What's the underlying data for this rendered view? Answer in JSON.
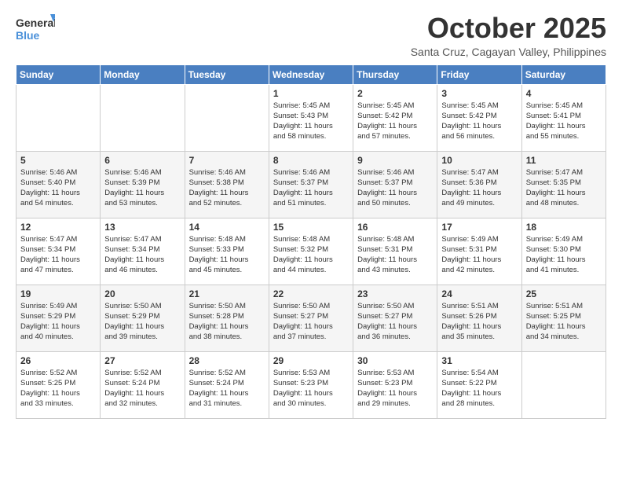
{
  "logo": {
    "line1": "General",
    "line2": "Blue"
  },
  "title": "October 2025",
  "subtitle": "Santa Cruz, Cagayan Valley, Philippines",
  "weekdays": [
    "Sunday",
    "Monday",
    "Tuesday",
    "Wednesday",
    "Thursday",
    "Friday",
    "Saturday"
  ],
  "weeks": [
    [
      {
        "day": "",
        "info": ""
      },
      {
        "day": "",
        "info": ""
      },
      {
        "day": "",
        "info": ""
      },
      {
        "day": "1",
        "info": "Sunrise: 5:45 AM\nSunset: 5:43 PM\nDaylight: 11 hours\nand 58 minutes."
      },
      {
        "day": "2",
        "info": "Sunrise: 5:45 AM\nSunset: 5:42 PM\nDaylight: 11 hours\nand 57 minutes."
      },
      {
        "day": "3",
        "info": "Sunrise: 5:45 AM\nSunset: 5:42 PM\nDaylight: 11 hours\nand 56 minutes."
      },
      {
        "day": "4",
        "info": "Sunrise: 5:45 AM\nSunset: 5:41 PM\nDaylight: 11 hours\nand 55 minutes."
      }
    ],
    [
      {
        "day": "5",
        "info": "Sunrise: 5:46 AM\nSunset: 5:40 PM\nDaylight: 11 hours\nand 54 minutes."
      },
      {
        "day": "6",
        "info": "Sunrise: 5:46 AM\nSunset: 5:39 PM\nDaylight: 11 hours\nand 53 minutes."
      },
      {
        "day": "7",
        "info": "Sunrise: 5:46 AM\nSunset: 5:38 PM\nDaylight: 11 hours\nand 52 minutes."
      },
      {
        "day": "8",
        "info": "Sunrise: 5:46 AM\nSunset: 5:37 PM\nDaylight: 11 hours\nand 51 minutes."
      },
      {
        "day": "9",
        "info": "Sunrise: 5:46 AM\nSunset: 5:37 PM\nDaylight: 11 hours\nand 50 minutes."
      },
      {
        "day": "10",
        "info": "Sunrise: 5:47 AM\nSunset: 5:36 PM\nDaylight: 11 hours\nand 49 minutes."
      },
      {
        "day": "11",
        "info": "Sunrise: 5:47 AM\nSunset: 5:35 PM\nDaylight: 11 hours\nand 48 minutes."
      }
    ],
    [
      {
        "day": "12",
        "info": "Sunrise: 5:47 AM\nSunset: 5:34 PM\nDaylight: 11 hours\nand 47 minutes."
      },
      {
        "day": "13",
        "info": "Sunrise: 5:47 AM\nSunset: 5:34 PM\nDaylight: 11 hours\nand 46 minutes."
      },
      {
        "day": "14",
        "info": "Sunrise: 5:48 AM\nSunset: 5:33 PM\nDaylight: 11 hours\nand 45 minutes."
      },
      {
        "day": "15",
        "info": "Sunrise: 5:48 AM\nSunset: 5:32 PM\nDaylight: 11 hours\nand 44 minutes."
      },
      {
        "day": "16",
        "info": "Sunrise: 5:48 AM\nSunset: 5:31 PM\nDaylight: 11 hours\nand 43 minutes."
      },
      {
        "day": "17",
        "info": "Sunrise: 5:49 AM\nSunset: 5:31 PM\nDaylight: 11 hours\nand 42 minutes."
      },
      {
        "day": "18",
        "info": "Sunrise: 5:49 AM\nSunset: 5:30 PM\nDaylight: 11 hours\nand 41 minutes."
      }
    ],
    [
      {
        "day": "19",
        "info": "Sunrise: 5:49 AM\nSunset: 5:29 PM\nDaylight: 11 hours\nand 40 minutes."
      },
      {
        "day": "20",
        "info": "Sunrise: 5:50 AM\nSunset: 5:29 PM\nDaylight: 11 hours\nand 39 minutes."
      },
      {
        "day": "21",
        "info": "Sunrise: 5:50 AM\nSunset: 5:28 PM\nDaylight: 11 hours\nand 38 minutes."
      },
      {
        "day": "22",
        "info": "Sunrise: 5:50 AM\nSunset: 5:27 PM\nDaylight: 11 hours\nand 37 minutes."
      },
      {
        "day": "23",
        "info": "Sunrise: 5:50 AM\nSunset: 5:27 PM\nDaylight: 11 hours\nand 36 minutes."
      },
      {
        "day": "24",
        "info": "Sunrise: 5:51 AM\nSunset: 5:26 PM\nDaylight: 11 hours\nand 35 minutes."
      },
      {
        "day": "25",
        "info": "Sunrise: 5:51 AM\nSunset: 5:25 PM\nDaylight: 11 hours\nand 34 minutes."
      }
    ],
    [
      {
        "day": "26",
        "info": "Sunrise: 5:52 AM\nSunset: 5:25 PM\nDaylight: 11 hours\nand 33 minutes."
      },
      {
        "day": "27",
        "info": "Sunrise: 5:52 AM\nSunset: 5:24 PM\nDaylight: 11 hours\nand 32 minutes."
      },
      {
        "day": "28",
        "info": "Sunrise: 5:52 AM\nSunset: 5:24 PM\nDaylight: 11 hours\nand 31 minutes."
      },
      {
        "day": "29",
        "info": "Sunrise: 5:53 AM\nSunset: 5:23 PM\nDaylight: 11 hours\nand 30 minutes."
      },
      {
        "day": "30",
        "info": "Sunrise: 5:53 AM\nSunset: 5:23 PM\nDaylight: 11 hours\nand 29 minutes."
      },
      {
        "day": "31",
        "info": "Sunrise: 5:54 AM\nSunset: 5:22 PM\nDaylight: 11 hours\nand 28 minutes."
      },
      {
        "day": "",
        "info": ""
      }
    ]
  ]
}
